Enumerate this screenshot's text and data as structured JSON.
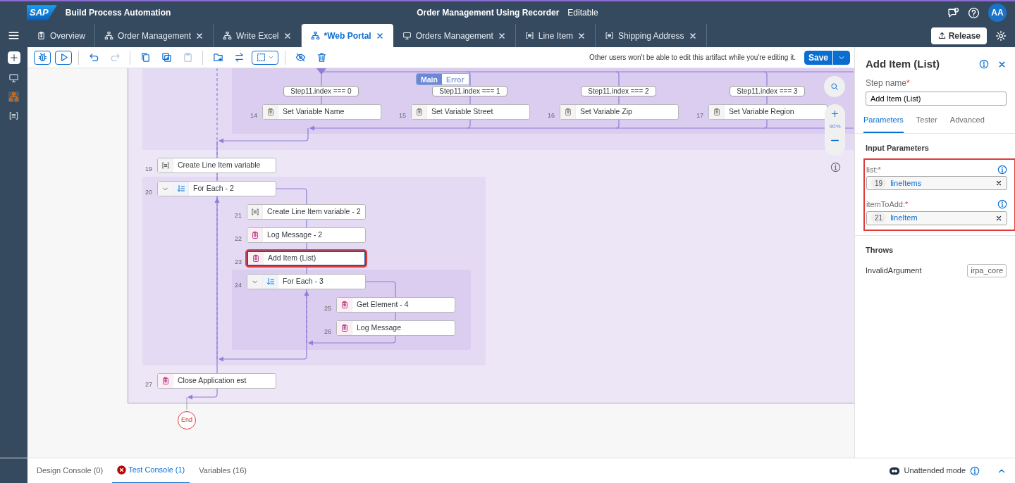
{
  "header": {
    "logo": "SAP",
    "product": "Build Process Automation",
    "title": "Order Management Using Recorder",
    "status": "Editable",
    "avatar": "AA"
  },
  "tabs": [
    {
      "label": "Overview",
      "kind": "overview",
      "selected": false,
      "closable": false
    },
    {
      "label": "Order Management",
      "kind": "automation",
      "selected": false,
      "closable": true
    },
    {
      "label": "Write Excel",
      "kind": "automation",
      "selected": false,
      "closable": true
    },
    {
      "label": "*Web Portal",
      "kind": "automation",
      "selected": true,
      "closable": true
    },
    {
      "label": "Orders Management",
      "kind": "application",
      "selected": false,
      "closable": true
    },
    {
      "label": "Line Item",
      "kind": "data_type",
      "selected": false,
      "closable": true
    },
    {
      "label": "Shipping Address",
      "kind": "data_type",
      "selected": false,
      "closable": true
    }
  ],
  "release_button": "Release",
  "rail": [
    {
      "kind": "application",
      "selected": false
    },
    {
      "kind": "automation",
      "selected": true
    },
    {
      "kind": "data_type",
      "selected": false
    }
  ],
  "toolbar": {
    "message": "Other users won't be able to edit this artifact while you're editing it.",
    "save": "Save"
  },
  "canvas": {
    "toggle": [
      {
        "label": "Main",
        "selected": true
      },
      {
        "label": "Error",
        "selected": false
      }
    ],
    "conditions": [
      "Step11.index === 0",
      "Step11.index === 1",
      "Step11.index === 2",
      "Step11.index === 3"
    ],
    "steps": [
      {
        "number": "14",
        "label": "Set Variable Name",
        "kind": "set",
        "selected": false
      },
      {
        "number": "15",
        "label": "Set Variable Street",
        "kind": "set",
        "selected": false
      },
      {
        "number": "16",
        "label": "Set Variable Zip",
        "kind": "set",
        "selected": false
      },
      {
        "number": "17",
        "label": "Set Variable Region",
        "kind": "set",
        "selected": false
      },
      {
        "number": "19",
        "label": "Create Line Item variable",
        "kind": "variable",
        "selected": false
      },
      {
        "number": "20",
        "label": "For Each - 2",
        "kind": "loop",
        "selected": false
      },
      {
        "number": "21",
        "label": "Create Line Item variable - 2",
        "kind": "variable",
        "selected": false
      },
      {
        "number": "22",
        "label": "Log Message - 2",
        "kind": "activity",
        "selected": false
      },
      {
        "number": "23",
        "label": "Add Item (List)",
        "kind": "activity",
        "selected": true
      },
      {
        "number": "24",
        "label": "For Each - 3",
        "kind": "loop",
        "selected": false
      },
      {
        "number": "25",
        "label": "Get Element - 4",
        "kind": "activity",
        "selected": false
      },
      {
        "number": "26",
        "label": "Log Message",
        "kind": "activity",
        "selected": false
      },
      {
        "number": "27",
        "label": "Close Application est",
        "kind": "activity",
        "selected": false
      }
    ],
    "zoom": "90%",
    "end": "End"
  },
  "panel": {
    "title": "Add Item (List)",
    "step_name_label": "Step name",
    "marker": "*",
    "step_name": "Add Item (List)",
    "tabs": [
      {
        "label": "Parameters",
        "selected": true
      },
      {
        "label": "Tester",
        "selected": false
      },
      {
        "label": "Advanced",
        "selected": false
      }
    ],
    "section": "Input Parameters",
    "params": [
      {
        "label": "list:",
        "ref": "19",
        "value": "lineItems"
      },
      {
        "label": "itemToAdd:",
        "ref": "21",
        "value": "lineItem"
      }
    ],
    "throws_title": "Throws",
    "throws": [
      {
        "name": "InvalidArgument",
        "source": "irpa_core"
      }
    ]
  },
  "console_tabs": [
    {
      "label": "Design Console (0)",
      "selected": false,
      "error": false
    },
    {
      "label": "Test Console (1)",
      "selected": true,
      "error": true
    },
    {
      "label": "Variables (16)",
      "selected": false,
      "error": false
    }
  ],
  "mode": "Unattended mode"
}
